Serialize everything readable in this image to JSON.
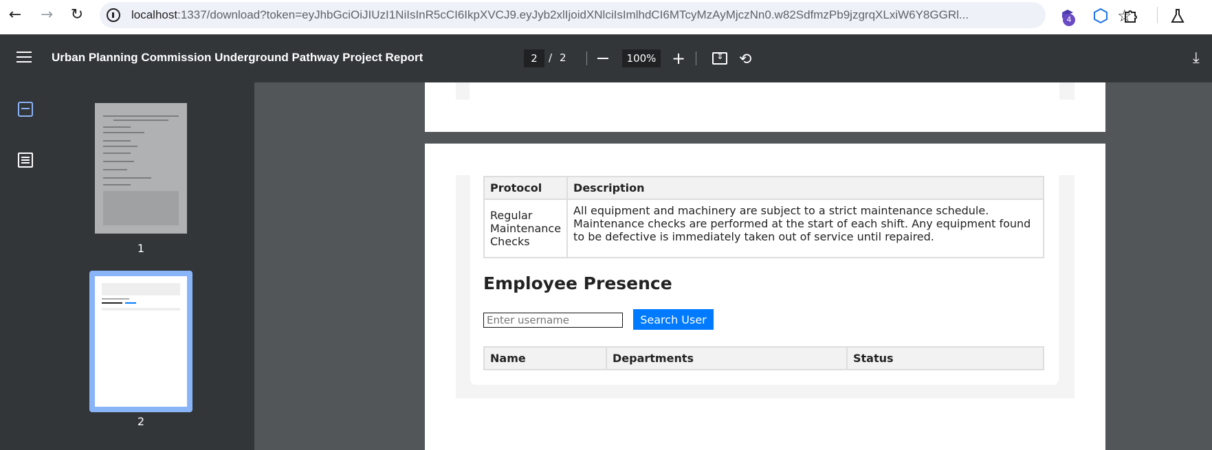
{
  "browser": {
    "url_host": "localhost",
    "url_rest": ":1337/download?token=eyJhbGciOiJIUzI1NiIsInR5cCI6IkpXVCJ9.eyJyb2xlIjoidXNlciIsImlhdCI6MTcyMzAyMjczNn0.w82SdfmzPb9jzgrqXLxiW6Y8GGRl...",
    "extension_badge": "4"
  },
  "toolbar": {
    "title": "Urban Planning Commission Underground Pathway Project Report",
    "current_page": "2",
    "page_separator": "/",
    "total_pages": "2",
    "zoom": "100%"
  },
  "sidebar": {
    "thumbnails": [
      {
        "label": "1"
      },
      {
        "label": "2"
      }
    ]
  },
  "document": {
    "protocol_table": {
      "headers": [
        "Protocol",
        "Description"
      ],
      "rows": [
        {
          "protocol": "Regular Maintenance Checks",
          "description": "All equipment and machinery are subject to a strict maintenance schedule. Maintenance checks are performed at the start of each shift. Any equipment found to be defective is immediately taken out of service until repaired."
        }
      ]
    },
    "employee_section": {
      "title": "Employee Presence",
      "search_placeholder": "Enter username",
      "search_button": "Search User",
      "table_headers": [
        "Name",
        "Departments",
        "Status"
      ]
    }
  },
  "colors": {
    "toolbar_bg": "#323639",
    "viewer_bg": "#525659",
    "accent": "#007bff",
    "thumb_selected": "#8ab4f8"
  }
}
